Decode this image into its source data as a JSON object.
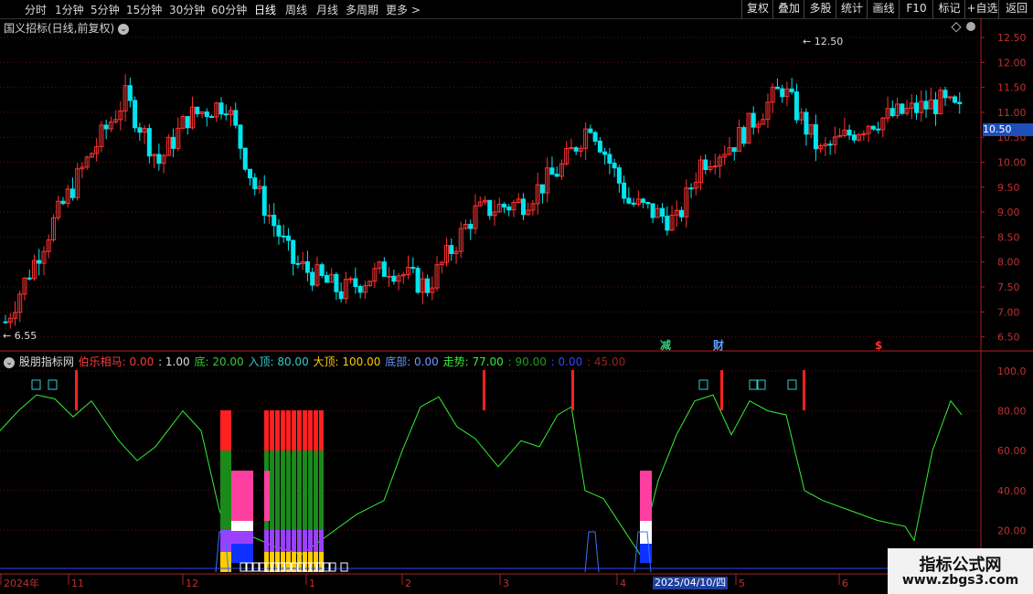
{
  "toolbar": {
    "periods": [
      "分时",
      "1分钟",
      "5分钟",
      "15分钟",
      "30分钟",
      "60分钟",
      "日线",
      "周线",
      "月线",
      "多周期",
      "更多 >"
    ],
    "active_period": "日线",
    "right_buttons": [
      "复权",
      "叠加",
      "多股",
      "统计",
      "画线",
      "F10",
      "标记",
      "+自选",
      "返回"
    ]
  },
  "main_chart": {
    "title": "国义招标(日线,前复权)",
    "high_label": "12.50",
    "low_label": "6.55",
    "current_price": "10.50",
    "price_ticks": [
      "12.50",
      "12.00",
      "11.50",
      "11.00",
      "10.50",
      "10.00",
      "9.50",
      "9.00",
      "8.50",
      "8.00",
      "7.50",
      "7.00",
      "6.50"
    ],
    "markers": [
      {
        "text": "减",
        "color": "#2fd07a"
      },
      {
        "text": "财",
        "color": "#5aa0ff"
      },
      {
        "text": "$",
        "color": "#ff3030"
      }
    ]
  },
  "indicator": {
    "name": "股朋指标网",
    "params": [
      {
        "text": "伯乐相马: 0.00",
        "color": "#ff3b3b"
      },
      {
        "text": ": 1.00",
        "color": "#dddddd"
      },
      {
        "text": "底: 20.00",
        "color": "#33cc33"
      },
      {
        "text": "入顶: 80.00",
        "color": "#33cccc"
      },
      {
        "text": "大顶: 100.00",
        "color": "#ffcc00"
      },
      {
        "text": "底部: 0.00",
        "color": "#6699ff"
      },
      {
        "text": "走势: 77.00",
        "color": "#33ee33"
      },
      {
        "text": ": 90.00",
        "color": "#229922"
      },
      {
        "text": ": 0.00",
        "color": "#3344ff"
      },
      {
        "text": ": 45.00",
        "color": "#992222"
      }
    ],
    "ticks": [
      "100.0",
      "80.00",
      "60.00",
      "40.00",
      "20.00"
    ]
  },
  "time_axis": {
    "labels": [
      "2024年",
      "11",
      "12",
      "1",
      "2",
      "3",
      "4",
      "5",
      "6"
    ],
    "cursor_date": "2025/04/10/四"
  },
  "watermark": {
    "line1": "指标公式网",
    "line2": "www.zbgs3.com"
  },
  "colors": {
    "up": "#ff3333",
    "down": "#00e5ee",
    "ma": "#33ff33",
    "bg": "#000000",
    "axis": "#b02020"
  }
}
